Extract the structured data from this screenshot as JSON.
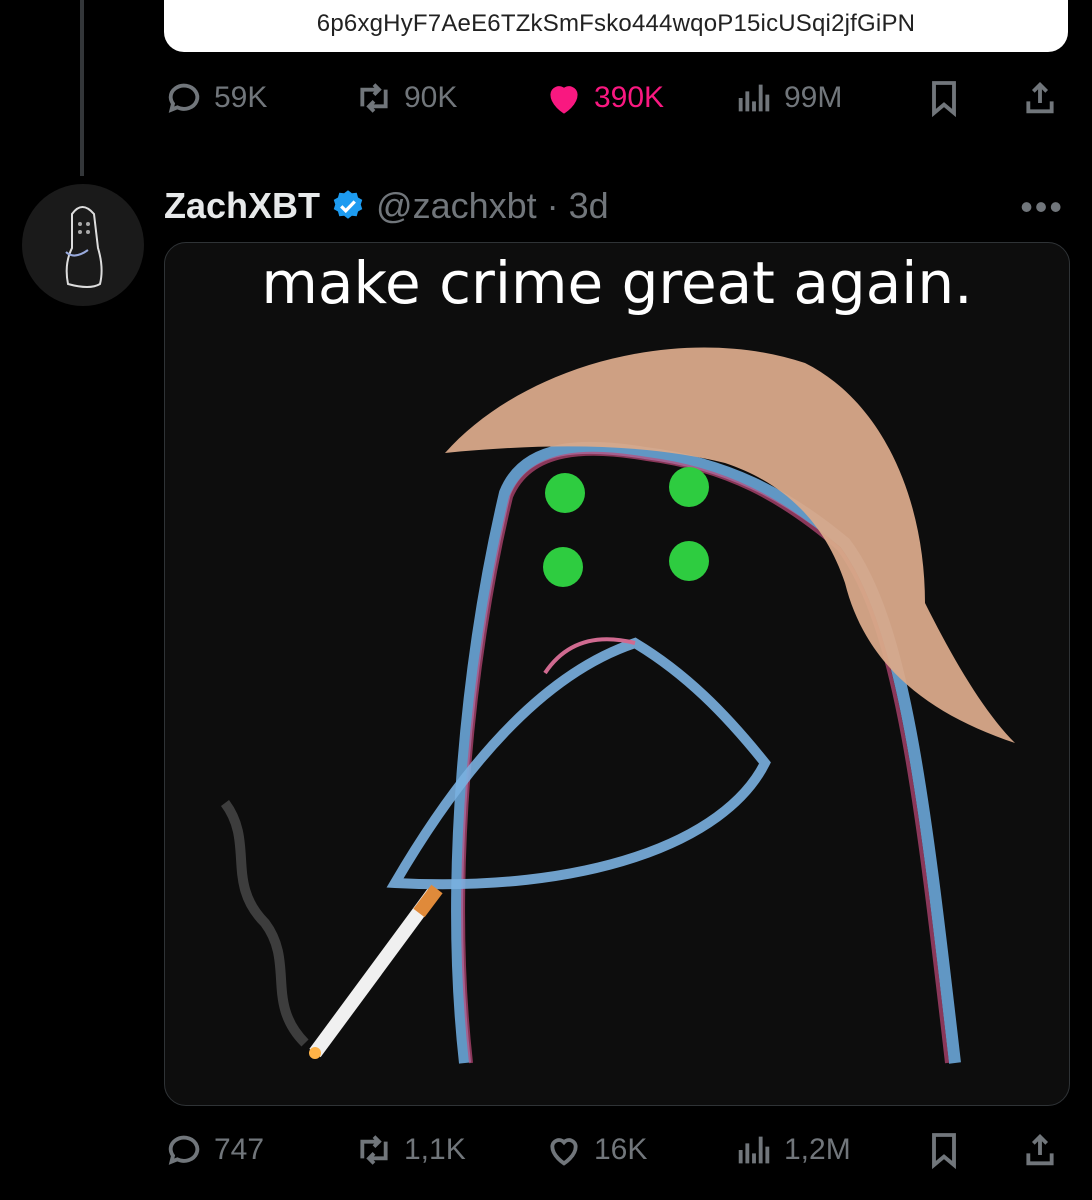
{
  "quoted_tweet": {
    "address": "6p6xgHyF7AeE6TZkSmFsko444wqoP15icUSqi2jfGiPN"
  },
  "previous_tweet_actions": {
    "replies": "59K",
    "reposts": "90K",
    "likes": "390K",
    "views": "99M"
  },
  "tweet": {
    "author_name": "ZachXBT",
    "handle": "@zachxbt",
    "separator": "·",
    "time": "3d",
    "more": "•••",
    "media_caption": "make crime great again.",
    "actions": {
      "replies": "747",
      "reposts": "1,1K",
      "likes": "16K",
      "views": "1,2M"
    }
  },
  "colors": {
    "background": "#000000",
    "text": "#e7e9ea",
    "muted": "#71767b",
    "like_active": "#f91880",
    "verified": "#1d9bf0"
  }
}
